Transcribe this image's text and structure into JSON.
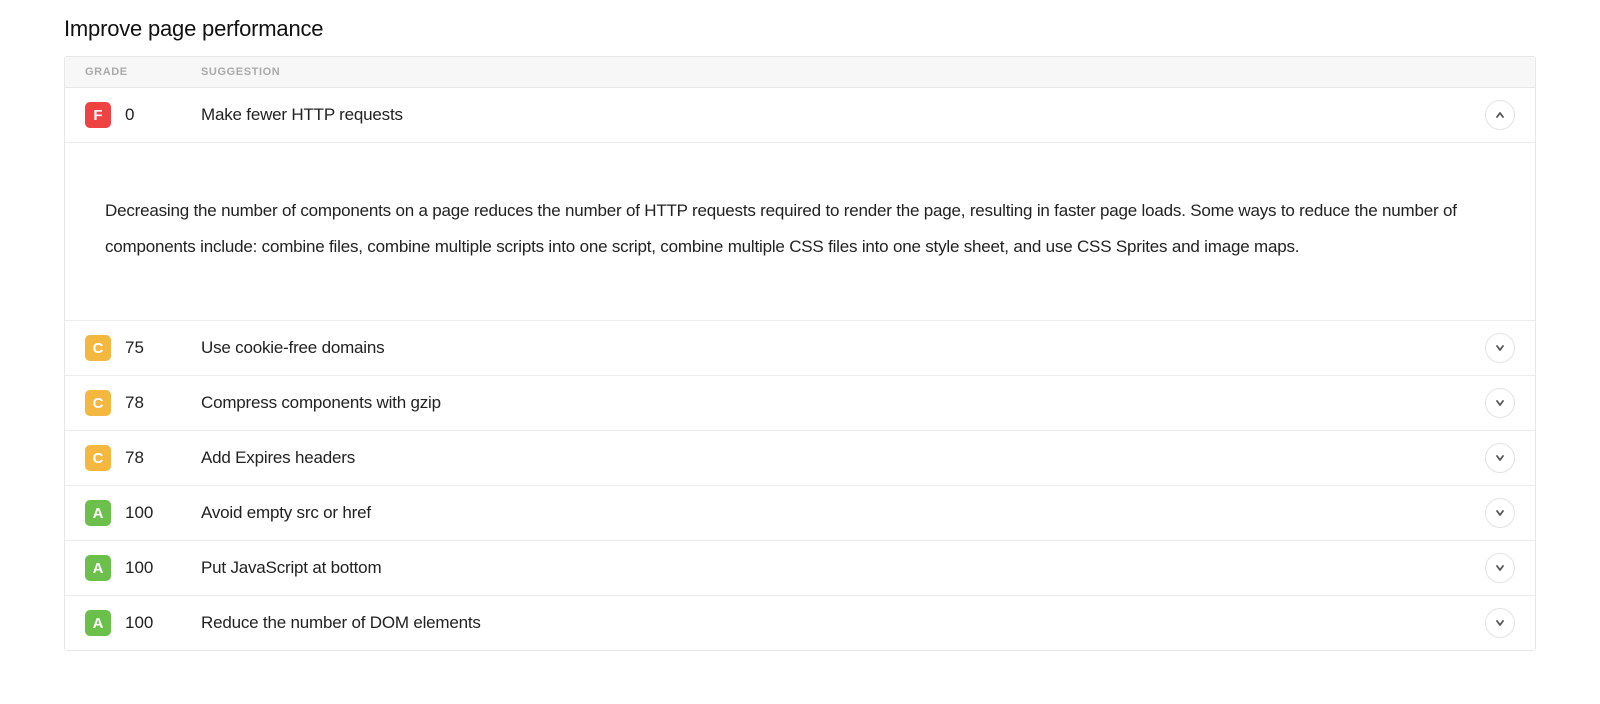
{
  "title": "Improve page performance",
  "header": {
    "grade": "GRADE",
    "suggestion": "SUGGESTION"
  },
  "items": [
    {
      "grade": "F",
      "score": "0",
      "suggestion": "Make fewer HTTP requests",
      "expanded": true,
      "detail": "Decreasing the number of components on a page reduces the number of HTTP requests required to render the page, resulting in faster page loads. Some ways to reduce the number of components include: combine files, combine multiple scripts into one script, combine multiple CSS files into one style sheet, and use CSS Sprites and image maps."
    },
    {
      "grade": "C",
      "score": "75",
      "suggestion": "Use cookie-free domains",
      "expanded": false
    },
    {
      "grade": "C",
      "score": "78",
      "suggestion": "Compress components with gzip",
      "expanded": false
    },
    {
      "grade": "C",
      "score": "78",
      "suggestion": "Add Expires headers",
      "expanded": false
    },
    {
      "grade": "A",
      "score": "100",
      "suggestion": "Avoid empty src or href",
      "expanded": false
    },
    {
      "grade": "A",
      "score": "100",
      "suggestion": "Put JavaScript at bottom",
      "expanded": false
    },
    {
      "grade": "A",
      "score": "100",
      "suggestion": "Reduce the number of DOM elements",
      "expanded": false
    }
  ]
}
